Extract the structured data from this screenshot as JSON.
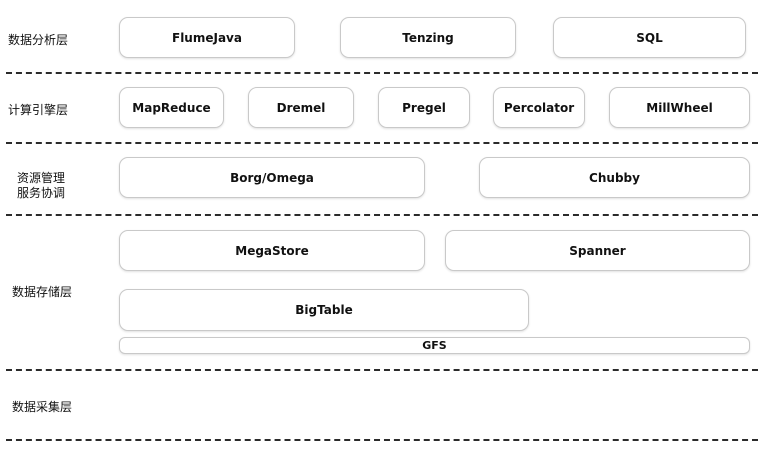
{
  "layers": {
    "analysis": {
      "label": "数据分析层",
      "components": [
        "FlumeJava",
        "Tenzing",
        "SQL"
      ]
    },
    "compute": {
      "label": "计算引擎层",
      "components": [
        "MapReduce",
        "Dremel",
        "Pregel",
        "Percolator",
        "MillWheel"
      ]
    },
    "resource": {
      "label_line1": "资源管理",
      "label_line2": "服务协调",
      "components": [
        "Borg/Omega",
        "Chubby"
      ]
    },
    "storage": {
      "label": "数据存储层",
      "components": [
        "MegaStore",
        "Spanner",
        "BigTable",
        "GFS"
      ]
    },
    "collection": {
      "label": "数据采集层"
    }
  }
}
